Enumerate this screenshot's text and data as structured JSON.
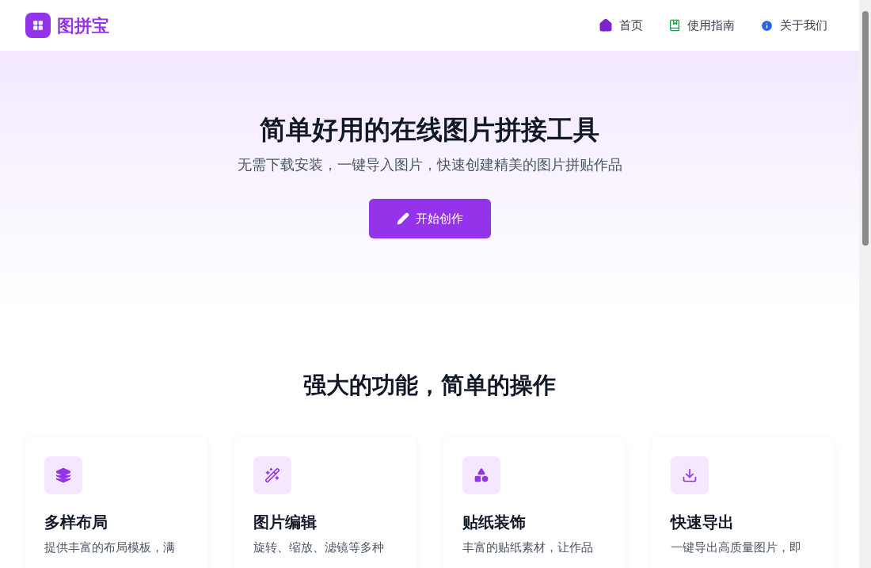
{
  "header": {
    "logo": "图拼宝",
    "nav": [
      {
        "label": "首页",
        "kind": "home"
      },
      {
        "label": "使用指南",
        "kind": "book"
      },
      {
        "label": "关于我们",
        "kind": "info"
      }
    ]
  },
  "hero": {
    "title": "简单好用的在线图片拼接工具",
    "subtitle": "无需下载安装，一键导入图片，快速创建精美的图片拼贴作品",
    "button": "开始创作"
  },
  "features": {
    "title": "强大的功能，简单的操作",
    "items": [
      {
        "kind": "layers",
        "title": "多样布局",
        "description": "提供丰富的布局模板，满"
      },
      {
        "kind": "wand",
        "title": "图片编辑",
        "description": "旋转、缩放、滤镜等多种"
      },
      {
        "kind": "shapes",
        "title": "贴纸装饰",
        "description": "丰富的贴纸素材，让作品"
      },
      {
        "kind": "download",
        "title": "快速导出",
        "description": "一键导出高质量图片，即"
      }
    ]
  }
}
